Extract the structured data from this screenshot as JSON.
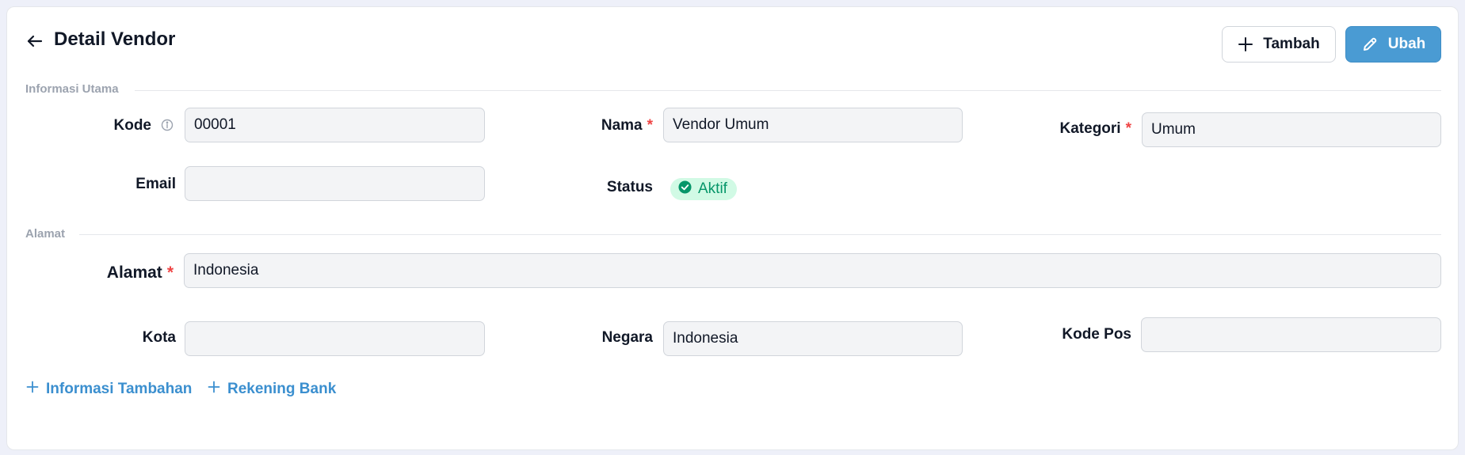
{
  "header": {
    "title": "Detail Vendor",
    "add_label": "Tambah",
    "edit_label": "Ubah"
  },
  "sections": {
    "main": "Informasi Utama",
    "address": "Alamat"
  },
  "fields": {
    "kode": {
      "label": "Kode",
      "value": "00001"
    },
    "nama": {
      "label": "Nama",
      "value": "Vendor Umum",
      "required": "*"
    },
    "kategori": {
      "label": "Kategori",
      "value": "Umum",
      "required": "*"
    },
    "email": {
      "label": "Email",
      "value": ""
    },
    "status": {
      "label": "Status",
      "value": "Aktif"
    },
    "alamat": {
      "label": "Alamat",
      "value": "Indonesia",
      "required": "*"
    },
    "kota": {
      "label": "Kota",
      "value": ""
    },
    "negara": {
      "label": "Negara",
      "value": "Indonesia"
    },
    "kode_pos": {
      "label": "Kode Pos",
      "value": ""
    }
  },
  "links": {
    "info_tambahan": "Informasi Tambahan",
    "rekening_bank": "Rekening Bank"
  },
  "colors": {
    "primary": "#4a9bd3",
    "link": "#3b8fcf",
    "required": "#ef4444",
    "status_bg": "#d1fae5",
    "status_fg": "#059669"
  },
  "icons": {
    "back": "arrow-left-icon",
    "add": "plus-icon",
    "edit": "pencil-icon",
    "info": "info-circle-icon",
    "status": "check-circle-icon"
  }
}
